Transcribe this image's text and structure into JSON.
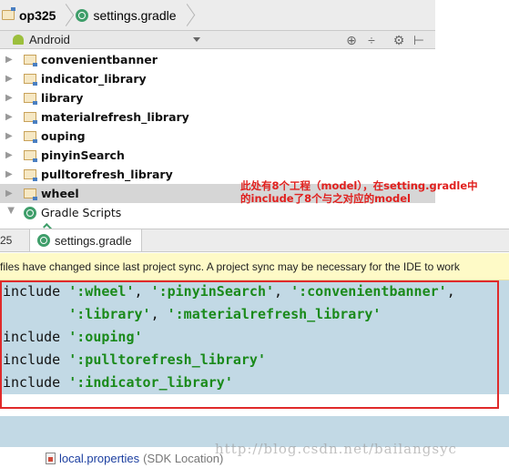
{
  "breadcrumb": {
    "project": "op325",
    "file": "settings.gradle"
  },
  "toolbar": {
    "view_mode": "Android",
    "icons": [
      "target-icon",
      "collapse-icon",
      "gear-icon",
      "hide-icon"
    ]
  },
  "tree": {
    "items": [
      {
        "label": "convenientbanner"
      },
      {
        "label": "indicator_library"
      },
      {
        "label": "library"
      },
      {
        "label": "materialrefresh_library"
      },
      {
        "label": "ouping"
      },
      {
        "label": "pinyinSearch"
      },
      {
        "label": "pulltorefresh_library"
      },
      {
        "label": "wheel"
      }
    ],
    "gradle_scripts": "Gradle Scripts"
  },
  "annotation": {
    "line1": "此处有8个工程（model），在setting.gradle中",
    "line2": "的include了8个与之对应的model"
  },
  "editor_tabs": {
    "left_partial": "25",
    "active": "settings.gradle"
  },
  "banner": {
    "text": "files have changed since last project sync. A project sync may be necessary for the IDE to work"
  },
  "code": {
    "keyword": "include",
    "lines": [
      [
        "':wheel'",
        ", ",
        "':pinyinSearch'",
        ", ",
        "':convenientbanner'",
        ","
      ],
      [
        "':library'",
        ", ",
        "':materialrefresh_library'"
      ],
      [
        "':ouping'"
      ],
      [
        "':pulltorefresh_library'"
      ],
      [
        "':indicator_library'"
      ]
    ]
  },
  "bottom_row": {
    "label": "local.properties",
    "hint": "(SDK Location)"
  },
  "watermark": "http://blog.csdn.net/bailangsyc",
  "colors": {
    "selection_gray": "#d6d6d6",
    "code_highlight": "#c2d9e5",
    "string_green": "#1a8a1a",
    "annotation_red": "#e0201e",
    "banner_yellow": "#fefac7"
  }
}
